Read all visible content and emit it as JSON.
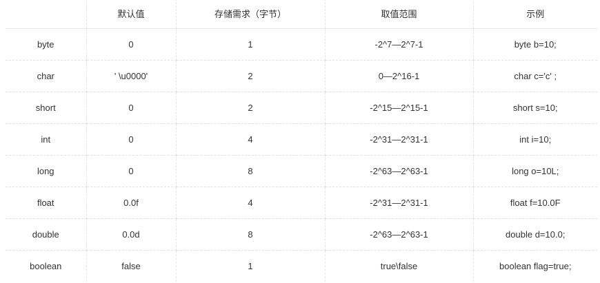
{
  "table": {
    "headers": [
      "",
      "默认值",
      "存储需求（字节）",
      "取值范围",
      "示例"
    ],
    "rows": [
      [
        "byte",
        "0",
        "1",
        "-2^7—2^7-1",
        "byte b=10;"
      ],
      [
        "char",
        "' \\u0000'",
        "2",
        "0—2^16-1",
        "char c='c' ;"
      ],
      [
        "short",
        "0",
        "2",
        "-2^15—2^15-1",
        "short s=10;"
      ],
      [
        "int",
        "0",
        "4",
        "-2^31—2^31-1",
        "int i=10;"
      ],
      [
        "long",
        "0",
        "8",
        "-2^63—2^63-1",
        "long o=10L;"
      ],
      [
        "float",
        "0.0f",
        "4",
        "-2^31—2^31-1",
        "float f=10.0F"
      ],
      [
        "double",
        "0.0d",
        "8",
        "-2^63—2^63-1",
        "double d=10.0;"
      ],
      [
        "boolean",
        "false",
        "1",
        "true\\false",
        "boolean flag=true;"
      ]
    ]
  }
}
